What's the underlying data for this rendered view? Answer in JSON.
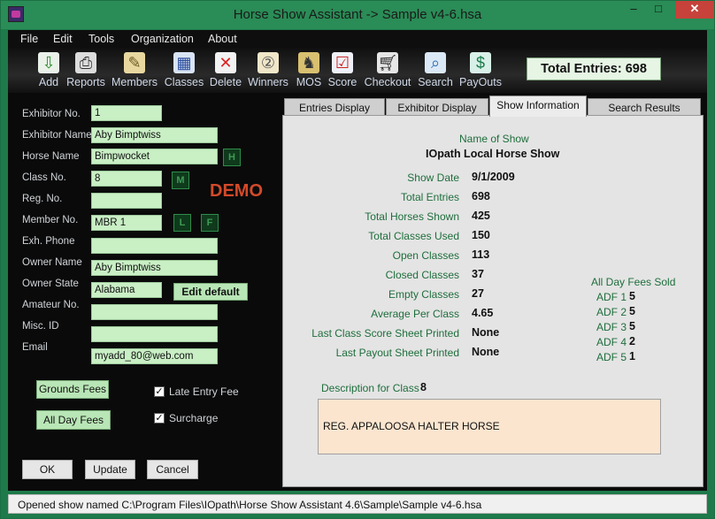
{
  "window": {
    "title": "Horse Show Assistant  ->  Sample v4-6.hsa",
    "min": "–",
    "max": "□",
    "close": "✕"
  },
  "menu": [
    "File",
    "Edit",
    "Tools",
    "Organization",
    "About"
  ],
  "toolbar": [
    {
      "label": "Add",
      "icon": "add-icon"
    },
    {
      "label": "Reports",
      "icon": "printer-icon"
    },
    {
      "label": "Members",
      "icon": "members-icon"
    },
    {
      "label": "Classes",
      "icon": "classes-icon"
    },
    {
      "label": "Delete",
      "icon": "delete-icon"
    },
    {
      "label": "Winners",
      "icon": "winners-icon"
    },
    {
      "label": "MOS",
      "icon": "mos-icon"
    },
    {
      "label": "Score",
      "icon": "score-icon"
    },
    {
      "label": "Checkout",
      "icon": "cart-icon"
    },
    {
      "label": "Search",
      "icon": "search-icon"
    },
    {
      "label": "PayOuts",
      "icon": "payouts-icon"
    }
  ],
  "total_entries": "Total Entries:  698",
  "form": {
    "exhibitor_no_label": "Exhibitor No.",
    "exhibitor_no": "1",
    "exhibitor_name_label": "Exhibitor Name",
    "exhibitor_name": "Aby Bimptwiss",
    "horse_name_label": "Horse Name",
    "horse_name": "Bimpwocket",
    "class_no_label": "Class No.",
    "class_no": "8",
    "reg_no_label": "Reg. No.",
    "reg_no": "",
    "member_no_label": "Member No.",
    "member_no": "MBR 1",
    "exh_phone_label": "Exh. Phone",
    "exh_phone": "",
    "owner_name_label": "Owner Name",
    "owner_name": "Aby Bimptwiss",
    "owner_state_label": "Owner State",
    "owner_state": "Alabama",
    "amateur_no_label": "Amateur No.",
    "amateur_no": "",
    "misc_id_label": "Misc. ID",
    "misc_id": "",
    "email_label": "Email",
    "email": "myadd_80@web.com",
    "h_btn": "H",
    "m_btn": "M",
    "l_btn": "L",
    "f_btn": "F",
    "edit_default": "Edit default",
    "demo": "DEMO",
    "grounds_fees": "Grounds Fees",
    "all_day_fees": "All Day Fees",
    "late_entry_fee": "Late Entry Fee",
    "surcharge": "Surcharge",
    "check": "✓",
    "ok": "OK",
    "update": "Update",
    "cancel": "Cancel"
  },
  "tabs": [
    "Entries Display",
    "Exhibitor Display",
    "Show Information",
    "Search Results"
  ],
  "show_info": {
    "name_label": "Name of Show",
    "name": "IOpath Local Horse Show",
    "rows": [
      {
        "label": "Show Date",
        "value": "9/1/2009"
      },
      {
        "label": "Total Entries",
        "value": "698"
      },
      {
        "label": "Total Horses Shown",
        "value": "425"
      },
      {
        "label": "Total Classes Used",
        "value": "150"
      },
      {
        "label": "Open Classes",
        "value": "113"
      },
      {
        "label": "Closed Classes",
        "value": "37"
      },
      {
        "label": "Empty Classes",
        "value": "27"
      },
      {
        "label": "Average Per Class",
        "value": "4.65"
      },
      {
        "label": "Last Class Score Sheet Printed",
        "value": "None"
      },
      {
        "label": "Last Payout Sheet Printed",
        "value": "None"
      }
    ],
    "adf_title": "All Day Fees Sold",
    "adf": [
      {
        "label": "ADF 1",
        "value": "5"
      },
      {
        "label": "ADF 2",
        "value": "5"
      },
      {
        "label": "ADF 3",
        "value": "5"
      },
      {
        "label": "ADF 4",
        "value": "2"
      },
      {
        "label": "ADF 5",
        "value": "1"
      }
    ],
    "desc_label": "Description for Class",
    "desc_class": "8",
    "description": "REG. APPALOOSA HALTER HORSE"
  },
  "status": "Opened show named C:\\Program Files\\IOpath\\Horse Show Assistant 4.6\\Sample\\Sample v4-6.hsa"
}
